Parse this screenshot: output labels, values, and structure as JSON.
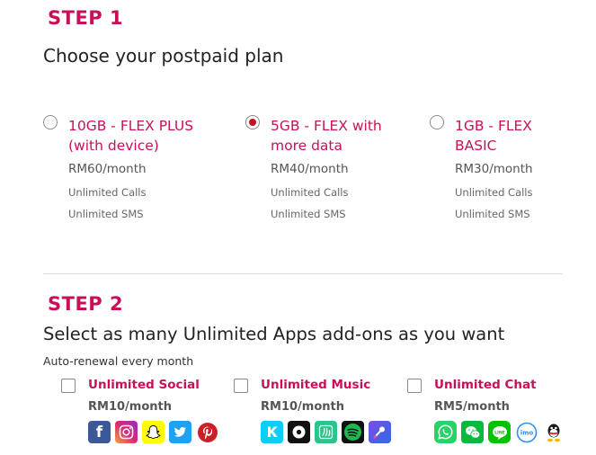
{
  "step1": {
    "title": "STEP 1",
    "heading": "Choose your postpaid plan",
    "plans": [
      {
        "name": "10GB - FLEX PLUS (with device)",
        "price": "RM60/month",
        "features": [
          "Unlimited Calls",
          "Unlimited SMS"
        ],
        "selected": false
      },
      {
        "name": "5GB - FLEX with more data",
        "price": "RM40/month",
        "features": [
          "Unlimited Calls",
          "Unlimited SMS"
        ],
        "selected": true
      },
      {
        "name": "1GB - FLEX BASIC",
        "price": "RM30/month",
        "features": [
          "Unlimited Calls",
          "Unlimited SMS"
        ],
        "selected": false
      }
    ]
  },
  "step2": {
    "title": "STEP 2",
    "heading": "Select as many Unlimited Apps add-ons as you want",
    "subtext": "Auto-renewal every month",
    "addons": [
      {
        "name": "Unlimited Social",
        "price": "RM10/month",
        "checked": false,
        "icons": [
          "facebook-icon",
          "instagram-icon",
          "snapchat-icon",
          "twitter-icon",
          "pinterest-icon"
        ]
      },
      {
        "name": "Unlimited Music",
        "price": "RM10/month",
        "checked": false,
        "icons": [
          "kkbox-icon",
          "joox-icon",
          "saavn-icon",
          "spotify-icon",
          "smule-icon"
        ]
      },
      {
        "name": "Unlimited Chat",
        "price": "RM5/month",
        "checked": false,
        "icons": [
          "whatsapp-icon",
          "wechat-icon",
          "line-icon",
          "imo-icon",
          "qq-icon"
        ]
      }
    ]
  },
  "colors": {
    "accent": "#c8105a",
    "radio_selected": "#cc0e1e",
    "facebook": "#3b5998",
    "instagram": "#c13584",
    "snapchat": "#fffc00",
    "twitter": "#1da1f2",
    "pinterest": "#cb2027",
    "kkbox": "#09cef6",
    "joox": "#111111",
    "saavn": "#2bc48a",
    "spotify": "#1db954",
    "smule": "#5b3fc4",
    "whatsapp": "#25d366",
    "wechat": "#09b83e",
    "line": "#00c300",
    "imo": "#2f8ff0",
    "qq": "#1a1a1a"
  }
}
